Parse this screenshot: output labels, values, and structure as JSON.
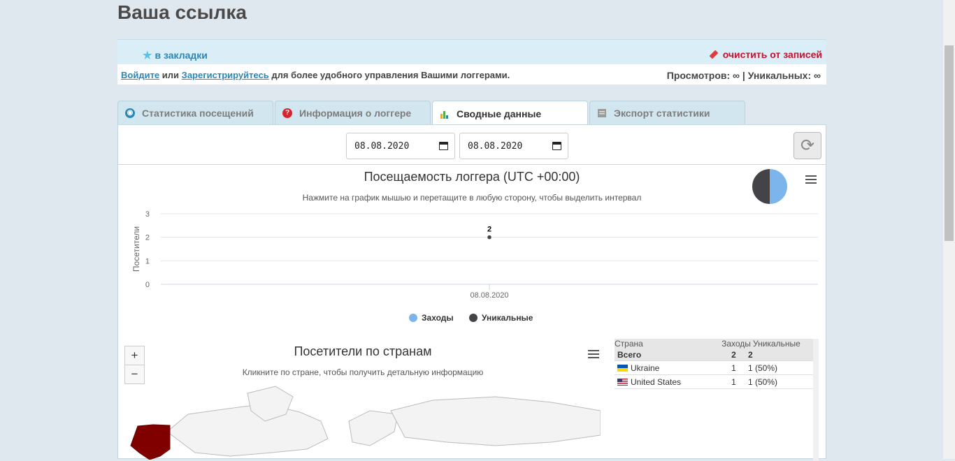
{
  "page_title": "Ваша ссылка",
  "topbar": {
    "bookmark_label": "в закладки",
    "clear_label": "очистить от записей"
  },
  "infobar": {
    "login_link": "Войдите",
    "or_text": "или",
    "register_link": "Зарегистрируйтесь",
    "suffix_text": "для более удобного управления Вашими логгерами.",
    "stats_text": "Просмотров: ∞ | Уникальных: ∞"
  },
  "tabs": [
    {
      "label": "Статистика посещений",
      "active": false,
      "icon": "eye-icon"
    },
    {
      "label": "Информация о логгере",
      "active": false,
      "icon": "question-icon"
    },
    {
      "label": "Сводные данные",
      "active": true,
      "icon": "bar-chart-icon"
    },
    {
      "label": "Экспорт статистики",
      "active": false,
      "icon": "export-icon"
    }
  ],
  "filters": {
    "date_from": "08.08.2020",
    "date_to": "08.08.2020"
  },
  "chart_data": [
    {
      "type": "line",
      "title": "Посещаемость логгера (UTC +00:00)",
      "subtitle": "Нажмите на график мышью и перетащите в любую сторону, чтобы выделить интервал",
      "ylabel": "Посетители",
      "xlabel": "",
      "categories": [
        "08.08.2020"
      ],
      "y_ticks": [
        0,
        1,
        2,
        3
      ],
      "ylim": [
        0,
        3
      ],
      "series": [
        {
          "name": "Заходы",
          "values": [
            2
          ],
          "color": "#7cb5ec"
        },
        {
          "name": "Уникальные",
          "values": [
            2
          ],
          "color": "#434348"
        }
      ],
      "data_labels": [
        "2"
      ],
      "legend_position": "bottom-center",
      "grid": true
    },
    {
      "type": "map",
      "title": "Посетители по странам",
      "subtitle": "Кликните по стране, чтобы получить детальную информацию",
      "highlighted": [
        {
          "country": "United States",
          "color": "#800000"
        }
      ]
    }
  ],
  "country_table": {
    "headers": [
      "Страна",
      "Заходы",
      "Уникальные"
    ],
    "total": {
      "label": "Всего",
      "visits": "2",
      "unique": "2"
    },
    "rows": [
      {
        "country": "Ukraine",
        "visits": "1",
        "unique": "1 (50%)",
        "flag": "flag-ua"
      },
      {
        "country": "United States",
        "visits": "1",
        "unique": "1 (50%)",
        "flag": "flag-us"
      }
    ]
  },
  "zoom": {
    "in": "+",
    "out": "−"
  }
}
